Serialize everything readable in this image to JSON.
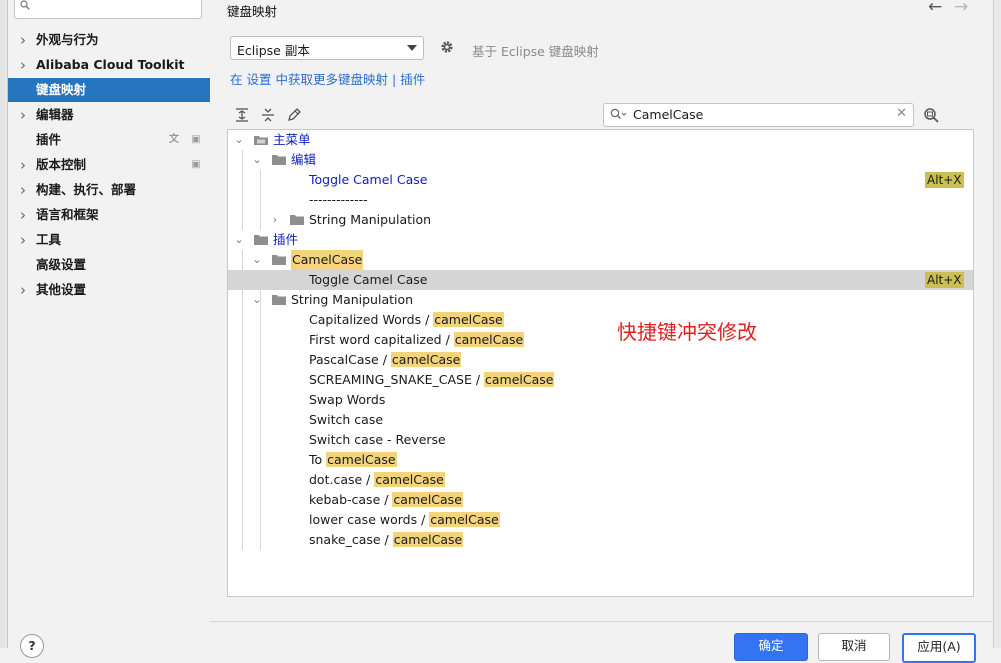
{
  "sidebar": {
    "search": {
      "value": ""
    },
    "items": [
      {
        "label": "外观与行为",
        "has_arrow": true
      },
      {
        "label": "Alibaba Cloud Toolkit",
        "has_arrow": true
      },
      {
        "label": "键盘映射",
        "has_arrow": false,
        "selected": true
      },
      {
        "label": "编辑器",
        "has_arrow": true
      },
      {
        "label": "插件",
        "has_arrow": false
      },
      {
        "label": "版本控制",
        "has_arrow": true
      },
      {
        "label": "构建、执行、部署",
        "has_arrow": true
      },
      {
        "label": "语言和框架",
        "has_arrow": true
      },
      {
        "label": "工具",
        "has_arrow": true
      },
      {
        "label": "高级设置",
        "has_arrow": false
      },
      {
        "label": "其他设置",
        "has_arrow": true
      }
    ]
  },
  "header": {
    "title": "键盘映射",
    "back_icon": "arrow-left-icon",
    "forward_icon": "arrow-right-icon"
  },
  "keymap": {
    "selected": "Eclipse 副本",
    "based_on": "基于 Eclipse 键盘映射",
    "link_prefix": "在",
    "link_settings": "设置",
    "link_middle": "中获取更多键盘映射",
    "link_sep": "|",
    "link_plugins": "插件"
  },
  "filter": {
    "value": "CamelCase"
  },
  "tree": {
    "main_menu": "主菜单",
    "edit": "编辑",
    "toggle_camel_case": "Toggle Camel Case",
    "separator": "-------------",
    "string_manipulation": "String Manipulation",
    "plugins": "插件",
    "camelcase_plugin": "CamelCase",
    "toggle_camel_case_2": "Toggle Camel Case",
    "string_manipulation_2": "String Manipulation",
    "shortcut": "Alt+X",
    "actions": [
      {
        "pre": "Capitalized Words / ",
        "hl": "camelCase"
      },
      {
        "pre": "First word capitalized / ",
        "hl": "camelCase"
      },
      {
        "pre": "PascalCase / ",
        "hl": "camelCase"
      },
      {
        "pre": "SCREAMING_SNAKE_CASE / ",
        "hl": "camelCase"
      },
      {
        "pre": "Swap Words",
        "hl": ""
      },
      {
        "pre": "Switch case",
        "hl": ""
      },
      {
        "pre": "Switch case - Reverse",
        "hl": ""
      },
      {
        "pre": "To ",
        "hl": "camelCase"
      },
      {
        "pre": "dot.case / ",
        "hl": "camelCase"
      },
      {
        "pre": "kebab-case / ",
        "hl": "camelCase"
      },
      {
        "pre": "lower case words / ",
        "hl": "camelCase"
      },
      {
        "pre": "snake_case / ",
        "hl": "camelCase"
      }
    ]
  },
  "annotation": "快捷键冲突修改",
  "footer": {
    "help": "?",
    "ok": "确定",
    "cancel": "取消",
    "apply": "应用(A)"
  },
  "colors": {
    "accent": "#2675bf",
    "link": "#2a6fc9",
    "annotation": "#e02020",
    "highlight": "#f4d37d"
  }
}
